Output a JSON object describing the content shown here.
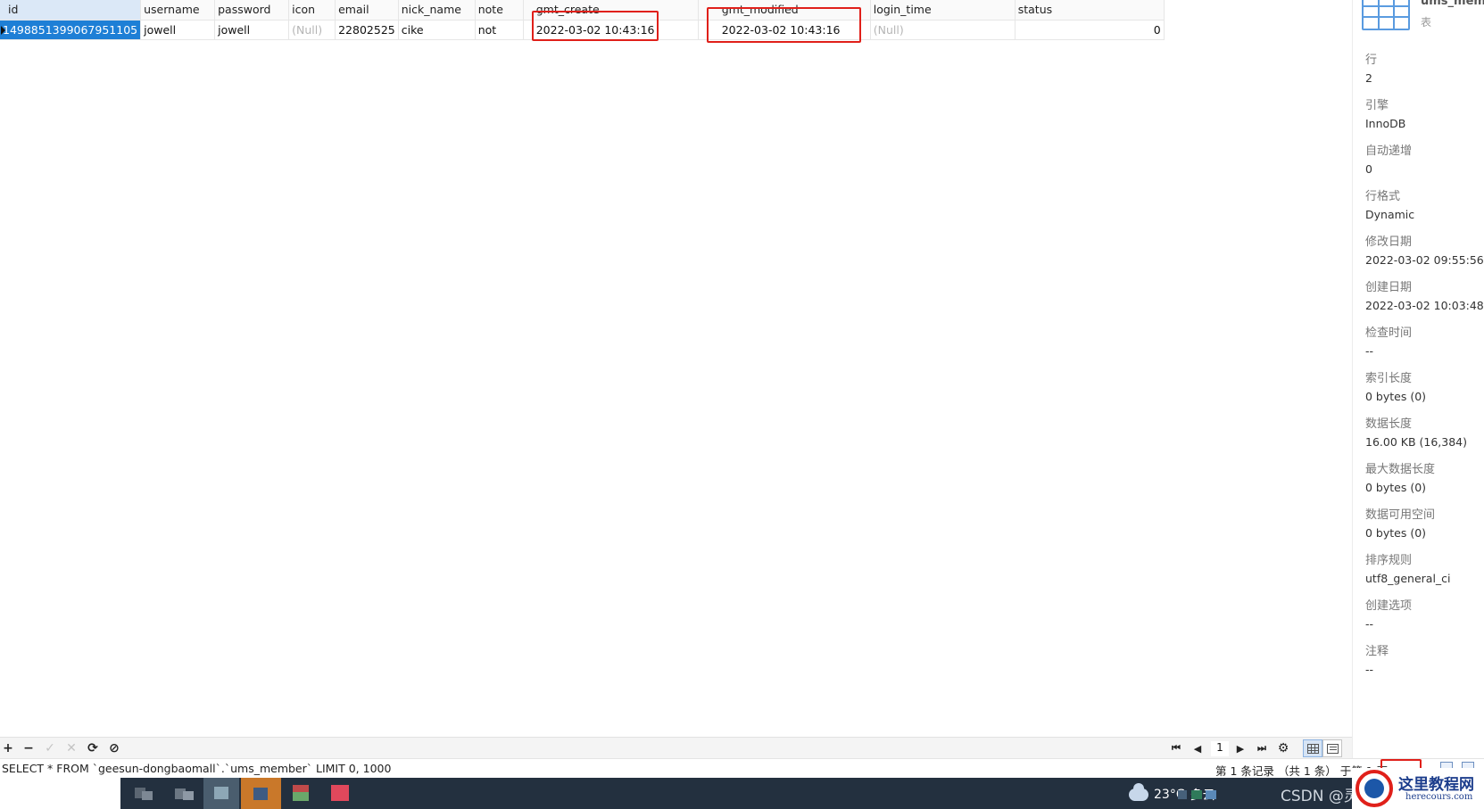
{
  "grid": {
    "columns": [
      "id",
      "username",
      "password",
      "icon",
      "email",
      "nick_name",
      "note",
      "gmt_create",
      "gmt_modified",
      "login_time",
      "status"
    ],
    "rows": [
      {
        "id": "1498851399067951105",
        "username": "jowell",
        "password": "jowell",
        "icon": "(Null)",
        "email": "22802525",
        "nick_name": "cike",
        "note": "not",
        "gmt_create": "2022-03-02 10:43:16",
        "gmt_modified": "2022-03-02 10:43:16",
        "login_time": "(Null)",
        "status": "0"
      }
    ]
  },
  "panel": {
    "table_name": "ums_mem",
    "object_type": "表",
    "props": [
      {
        "k": "行",
        "v": "2"
      },
      {
        "k": "引擎",
        "v": "InnoDB"
      },
      {
        "k": "自动递增",
        "v": "0"
      },
      {
        "k": "行格式",
        "v": "Dynamic"
      },
      {
        "k": "修改日期",
        "v": "2022-03-02 09:55:56"
      },
      {
        "k": "创建日期",
        "v": "2022-03-02 10:03:48"
      },
      {
        "k": "检查时间",
        "v": "--"
      },
      {
        "k": "索引长度",
        "v": "0 bytes (0)"
      },
      {
        "k": "数据长度",
        "v": "16.00 KB (16,384)"
      },
      {
        "k": "最大数据长度",
        "v": "0 bytes (0)"
      },
      {
        "k": "数据可用空间",
        "v": "0 bytes (0)"
      },
      {
        "k": "排序规则",
        "v": "utf8_general_ci"
      },
      {
        "k": "创建选项",
        "v": "--"
      },
      {
        "k": "注释",
        "v": "--"
      }
    ]
  },
  "toolbar": {
    "add": "+",
    "remove": "−",
    "apply": "✓",
    "discard": "✕",
    "refresh": "⟳",
    "stop": "⊘",
    "first": "⏮",
    "prev": "◀",
    "page": "1",
    "next": "▶",
    "last": "⏭",
    "settings": "⚙"
  },
  "status": {
    "sql": "SELECT * FROM `geesun-dongbaomall`.`ums_member` LIMIT 0, 1000",
    "records": "第 1 条记录 （共 1 条） 于第 1 页"
  },
  "taskbar": {
    "temperature": "23°C",
    "weather": "多云",
    "watermark": "CSDN @灵"
  },
  "watermark": {
    "title": "这里教程网",
    "url": "herecours.com"
  },
  "colors": {
    "selection": "#1e7fd6",
    "highlight_box": "#e0201a",
    "taskbar": "#23303f"
  }
}
